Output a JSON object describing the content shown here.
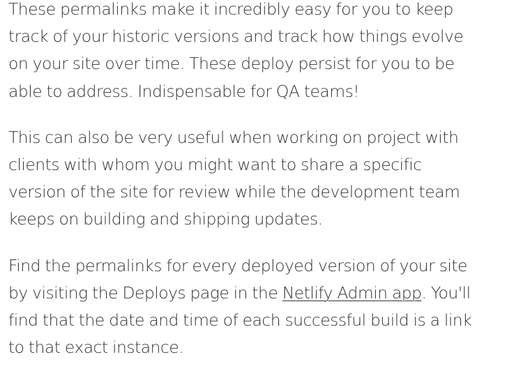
{
  "article": {
    "paragraphs": [
      {
        "lines": [
          "These permalinks make it incredibly easy for you to keep",
          "track of your historic versions and track how things evolve",
          "on your site over time. These deploy persist for you to be",
          "able to address. Indispensable for QA teams!"
        ]
      },
      {
        "lines": [
          "This can also be very useful when working on project with",
          "clients with whom you might want to share a specific",
          "version of the site for review while the development team",
          "keeps on building and shipping updates."
        ]
      },
      {
        "line1": "Find the permalinks for every deployed version of your site",
        "line2_before": "by visiting the Deploys page in the ",
        "link_text": "Netlify Admin app",
        "line2_after": ". You'll",
        "line3": "find that the date and time of each successful build is a link",
        "line4": "to that exact instance."
      }
    ]
  }
}
